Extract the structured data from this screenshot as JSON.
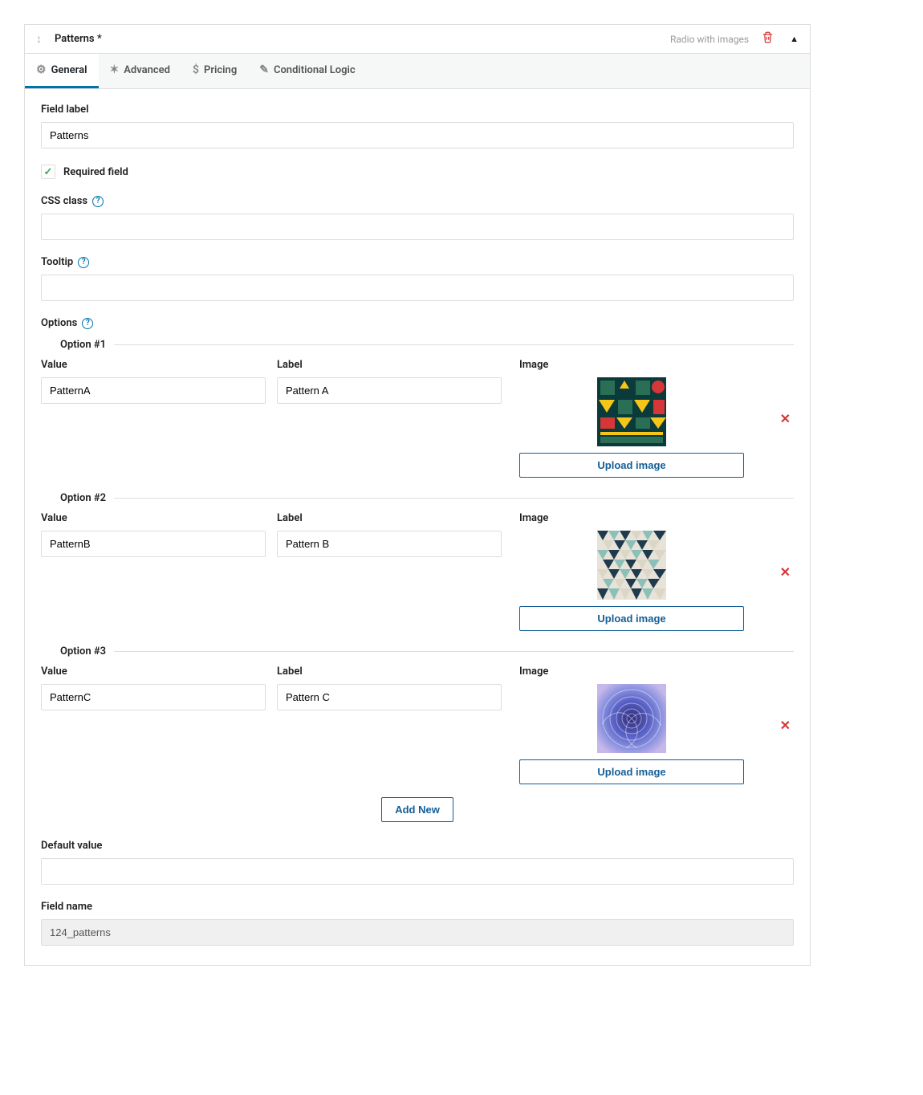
{
  "header": {
    "title": "Patterns *",
    "field_type": "Radio with images"
  },
  "tabs": [
    {
      "label": "General",
      "icon": "gear-icon"
    },
    {
      "label": "Advanced",
      "icon": "sliders-icon"
    },
    {
      "label": "Pricing",
      "icon": "dollar-icon"
    },
    {
      "label": "Conditional Logic",
      "icon": "wand-icon"
    }
  ],
  "form": {
    "field_label": {
      "label": "Field label",
      "value": "Patterns"
    },
    "required": {
      "label": "Required field",
      "checked": true
    },
    "css_class": {
      "label": "CSS class",
      "value": ""
    },
    "tooltip": {
      "label": "Tooltip",
      "value": ""
    },
    "options_label": "Options",
    "options_header": {
      "value": "Value",
      "label": "Label",
      "image": "Image"
    },
    "options": [
      {
        "title": "Option #1",
        "value": "PatternA",
        "label": "Pattern A"
      },
      {
        "title": "Option #2",
        "value": "PatternB",
        "label": "Pattern B"
      },
      {
        "title": "Option #3",
        "value": "PatternC",
        "label": "Pattern C"
      }
    ],
    "upload_button": "Upload image",
    "add_new": "Add New",
    "default_value": {
      "label": "Default value",
      "value": ""
    },
    "field_name": {
      "label": "Field name",
      "value": "124_patterns"
    }
  }
}
